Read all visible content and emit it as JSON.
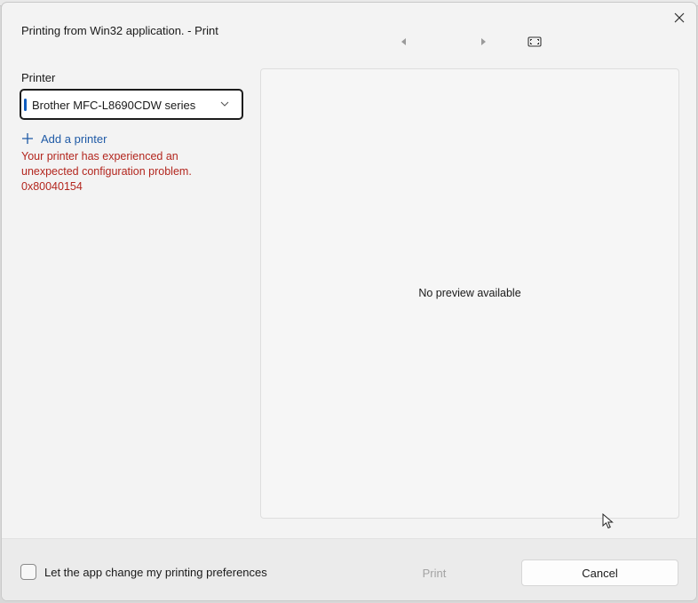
{
  "window": {
    "title": "Printing from Win32 application. - Print"
  },
  "toolbar": {
    "close_icon": "close-icon",
    "prev_icon": "triangle-left-icon",
    "next_icon": "triangle-right-icon",
    "fit_icon": "fit-page-icon"
  },
  "printer": {
    "label": "Printer",
    "selected": "Brother MFC-L8690CDW series",
    "add_label": "Add a printer",
    "error_lines": [
      "Your printer has experienced an",
      "unexpected configuration problem.",
      "0x80040154"
    ]
  },
  "preview": {
    "message": "No preview available"
  },
  "footer": {
    "checkbox_label": "Let the app change my printing preferences",
    "checkbox_checked": false,
    "print_label": "Print",
    "print_enabled": false,
    "cancel_label": "Cancel"
  },
  "colors": {
    "accent": "#0f5cbf",
    "link": "#1f5aa6",
    "error": "#b3261e",
    "disabled_text": "#a3a3a3"
  }
}
